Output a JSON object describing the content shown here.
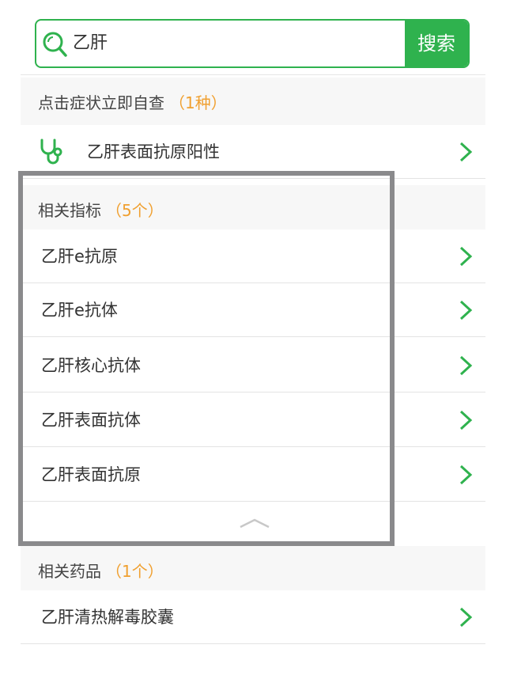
{
  "search": {
    "query": "乙肝",
    "button_label": "搜索",
    "icon": "search-icon"
  },
  "symptom_section": {
    "title": "点击症状立即自查",
    "count": "（1种）",
    "item": {
      "label": "乙肝表面抗原阳性",
      "icon": "stethoscope-icon"
    }
  },
  "indicator_section": {
    "title": "相关指标",
    "count": "（5个）",
    "items": [
      "乙肝e抗原",
      "乙肝e抗体",
      "乙肝核心抗体",
      "乙肝表面抗体",
      "乙肝表面抗原"
    ],
    "collapse_icon": "chevron-up-icon"
  },
  "drug_section": {
    "title": "相关药品",
    "count": "（1个）",
    "items": [
      "乙肝清热解毒胶囊"
    ]
  },
  "colors": {
    "accent": "#2fb24e",
    "count": "#f0a030",
    "highlight_border": "#8a8a8c"
  }
}
